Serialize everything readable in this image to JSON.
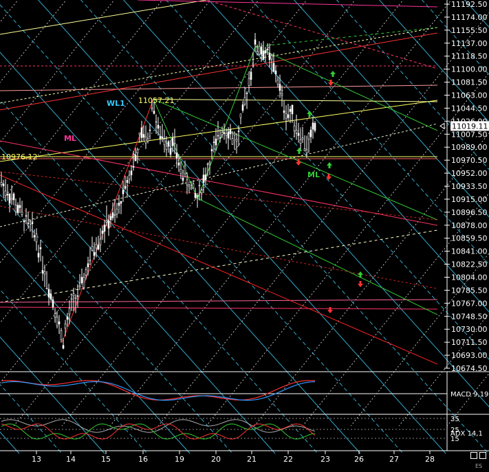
{
  "chart_data": {
    "type": "candlestick",
    "y_ticks": [
      "11192.50",
      "11174.00",
      "11155.50",
      "11137.00",
      "11118.50",
      "11100.00",
      "11081.50",
      "11063.00",
      "11044.50",
      "11026.00",
      "11007.50",
      "10989.00",
      "10970.50",
      "10952.00",
      "10933.50",
      "10915.00",
      "10896.50",
      "10878.00",
      "10859.50",
      "10841.00",
      "10822.50",
      "10804.00",
      "10785.50",
      "10767.00",
      "10748.50",
      "10730.00",
      "10711.50",
      "10693.00",
      "10674.50"
    ],
    "ylim": [
      10674.5,
      11192.5
    ],
    "x_ticks": [
      "13",
      "14",
      "15",
      "16",
      "19",
      "20",
      "21",
      "22",
      "23",
      "26",
      "27",
      "28"
    ],
    "last_price": "11019.11",
    "annotations": [
      {
        "text": "WL1",
        "color": "#33ccff"
      },
      {
        "text": "11057.21",
        "color": "#ffff66"
      },
      {
        "text": "ML",
        "color": "#ff3399"
      },
      {
        "text": "10976.12",
        "color": "#ffff66"
      },
      {
        "text": "ML",
        "color": "#33cc33"
      }
    ],
    "pitchfork_points": [
      {
        "day": 13.75,
        "price": 10712
      },
      {
        "day": 16.85,
        "price": 11057.21
      },
      {
        "day": 19.5,
        "price": 10916
      },
      {
        "day": 21.1,
        "price": 11132
      },
      {
        "day": 22.5,
        "price": 10990
      }
    ],
    "indicators": [
      {
        "name": "MACD 9,19",
        "series": [
          {
            "name": "MACD",
            "color": "#ff3333"
          },
          {
            "name": "Signal",
            "color": "#3399ff"
          }
        ]
      },
      {
        "name": "ADX 14,1",
        "levels": [
          "35",
          "25",
          "15"
        ],
        "series": [
          {
            "name": "ADX",
            "color": "#aaaaaa"
          },
          {
            "name": "+DI",
            "color": "#33cc33"
          },
          {
            "name": "-DI",
            "color": "#ff3333"
          }
        ]
      }
    ],
    "colors": {
      "background": "#000000",
      "candle": "#ffffff",
      "text": "#ffffff"
    }
  },
  "footer": {
    "corner_label": "ES"
  }
}
